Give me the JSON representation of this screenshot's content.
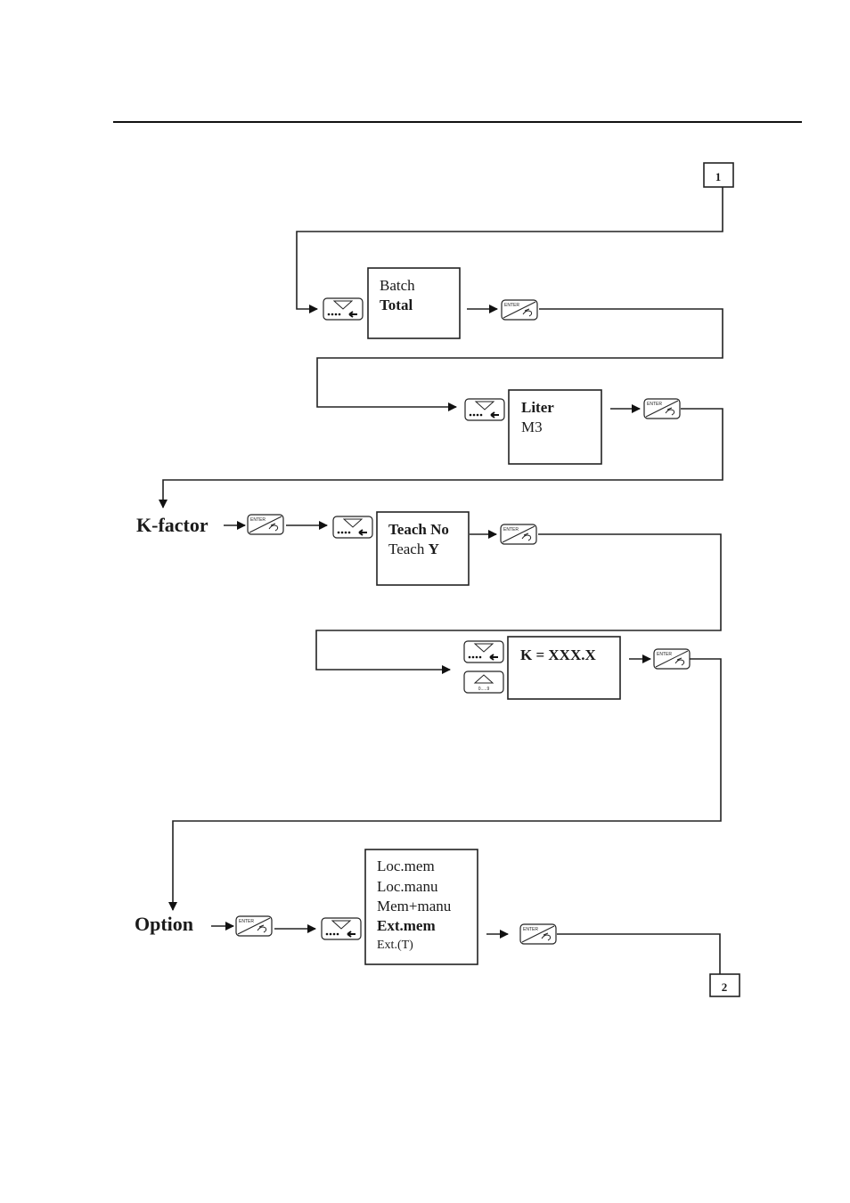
{
  "connectors": {
    "start": "1",
    "end": "2"
  },
  "sections": {
    "kfactor": "K-factor",
    "option": "Option"
  },
  "keys": {
    "enter": "ENTER",
    "digits": "0.....9"
  },
  "menus": {
    "mode": {
      "items": [
        {
          "label": "Batch",
          "selected": false
        },
        {
          "label": "Total",
          "selected": true
        }
      ]
    },
    "unit": {
      "items": [
        {
          "label": "Liter",
          "selected": true
        },
        {
          "label": "M3",
          "selected": false
        }
      ]
    },
    "teach": {
      "line1_a": "Teach ",
      "line1_b": "No",
      "line2_a": "Teach ",
      "line2_b": "Y"
    },
    "kvalue": {
      "label": "K = XXX.X"
    },
    "option": {
      "items": [
        {
          "label": "Loc.mem",
          "selected": false
        },
        {
          "label": "Loc.manu",
          "selected": false
        },
        {
          "label": "Mem+manu",
          "selected": false
        },
        {
          "label": "Ext.mem",
          "selected": true
        },
        {
          "label": "Ext.(T)",
          "selected": false
        }
      ]
    }
  }
}
